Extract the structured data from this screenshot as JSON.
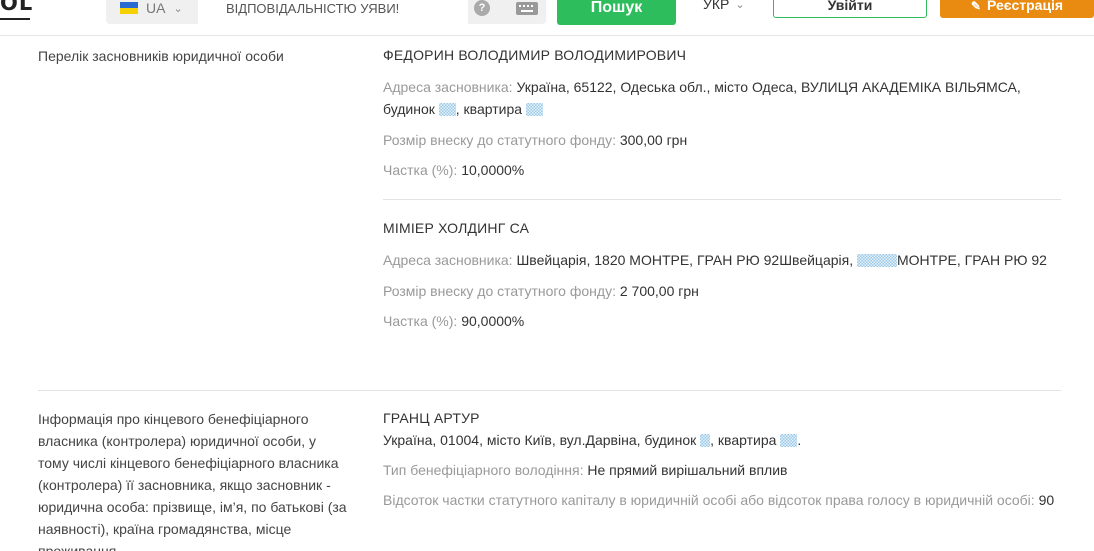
{
  "header": {
    "logo_text": "OL",
    "country": "UA",
    "search_value": "ВІДПОВІДАЛЬНІСТЮ УЯВИ!",
    "search_button": "Пошук",
    "language": "УКР",
    "login_button": "Увійти",
    "register_button": "Реєстрація"
  },
  "founders": {
    "label": "Перелік засновників юридичної особи",
    "items": [
      {
        "name": "ФЕДОРИН ВОЛОДИМИР ВОЛОДИМИРОВИЧ",
        "address_key": "Адреса засновника:",
        "address_part1": "Україна, 65122, Одеська обл., місто Одеса, ВУЛИЦЯ АКАДЕМІКА ВІЛЬЯМСА, будинок",
        "address_part2": ", квартира",
        "contribution_key": "Розмір внеску до статутного фонду:",
        "contribution_value": "300,00 грн",
        "share_key": "Частка (%):",
        "share_value": "10,0000%"
      },
      {
        "name": "МІМІЕР ХОЛДИНГ СА",
        "address_key": "Адреса засновника:",
        "address_part1": "Швейцарія, 1820 МОНТРЕ, ГРАН РЮ 92Швейцарія,",
        "address_part2": "МОНТРЕ, ГРАН РЮ 92",
        "contribution_key": "Розмір внеску до статутного фонду:",
        "contribution_value": "2 700,00 грн",
        "share_key": "Частка (%):",
        "share_value": "90,0000%"
      }
    ]
  },
  "beneficiary": {
    "label": "Інформація про кінцевого бенефіціарного власника (контролера) юридичної особи, у тому числі кінцевого бенефіціарного власника (контролера) її засновника, якщо засновник - юридична особа: прізвище, ім’я, по батькові (за наявності), країна громадянства, місце проживання",
    "name": "ГРАНЦ АРТУР",
    "address_part1": "Україна, 01004, місто Київ, вул.Дарвіна, будинок",
    "address_part2": ", квартира",
    "address_part3": ".",
    "type_key": "Тип бенефіціарного володіння:",
    "type_value": "Не прямий вирішальний вплив",
    "percent_key": "Відсоток частки статутного капіталу в юридичній особі або відсоток права голосу в юридичній особі:",
    "percent_value": "90"
  }
}
